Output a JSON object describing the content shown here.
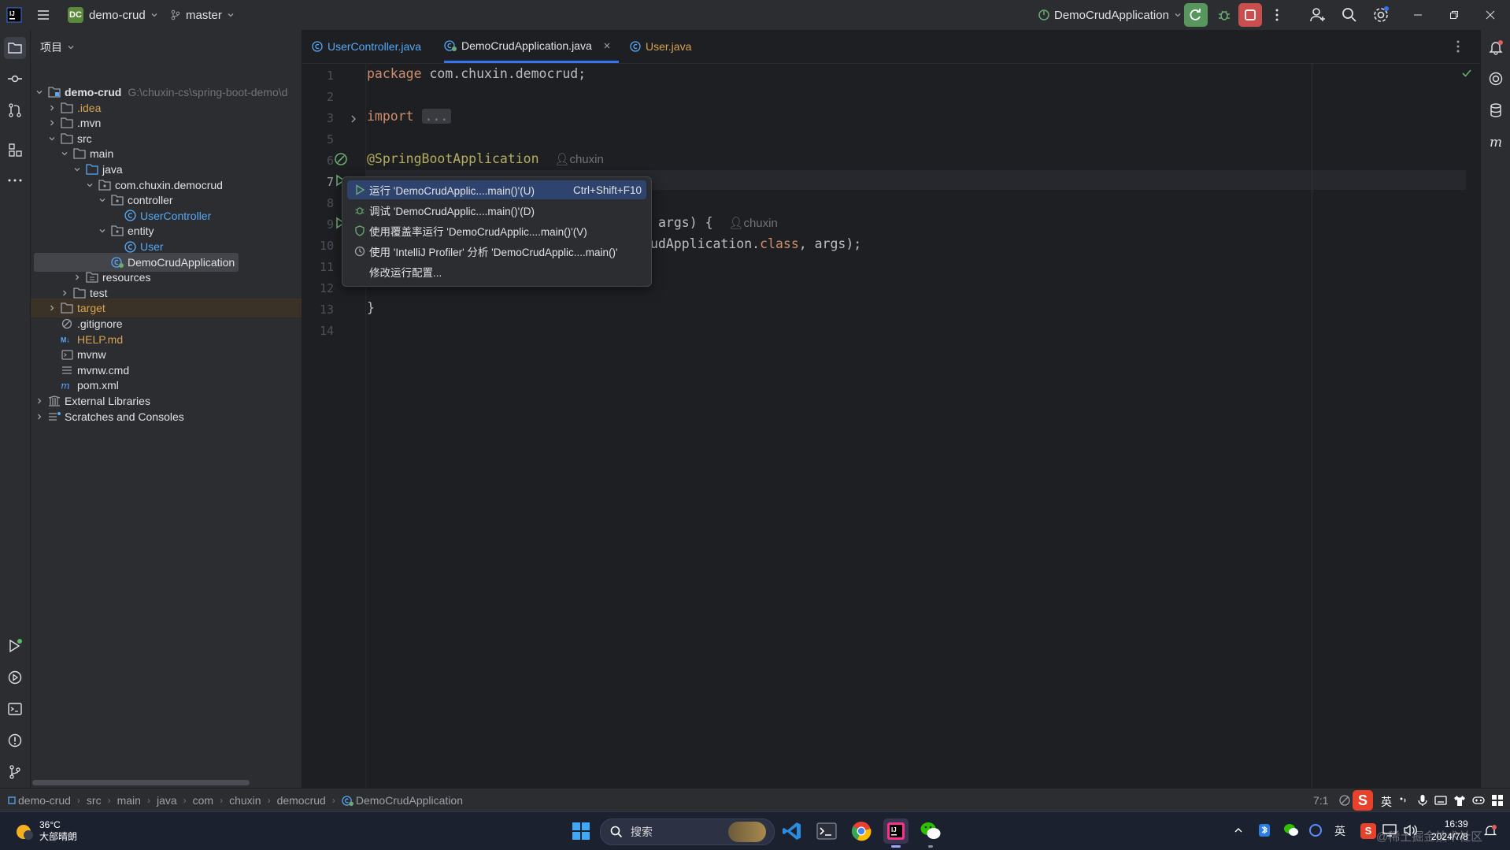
{
  "titlebar": {
    "project_badge": "DC",
    "project_name": "demo-crud",
    "branch": "master",
    "run_config": "DemoCrudApplication"
  },
  "project_panel": {
    "title": "项目",
    "tree": [
      {
        "label": "demo-crud",
        "path": "G:\\chuxin-cs\\spring-boot-demo\\d",
        "level": 0,
        "icon": "module-folder-icon",
        "expanded": true,
        "bold": true
      },
      {
        "label": ".idea",
        "level": 1,
        "icon": "folder-icon",
        "collapsed": true,
        "excluded": true
      },
      {
        "label": ".mvn",
        "level": 1,
        "icon": "folder-icon",
        "collapsed": true
      },
      {
        "label": "src",
        "level": 1,
        "icon": "folder-icon",
        "expanded": true
      },
      {
        "label": "main",
        "level": 2,
        "icon": "folder-icon",
        "expanded": true
      },
      {
        "label": "java",
        "level": 3,
        "icon": "source-folder-icon",
        "expanded": true
      },
      {
        "label": "com.chuxin.democrud",
        "level": 4,
        "icon": "package-icon",
        "expanded": true
      },
      {
        "label": "controller",
        "level": 5,
        "icon": "package-icon",
        "expanded": true
      },
      {
        "label": "UserController",
        "level": 6,
        "icon": "class-icon",
        "leaf": true,
        "cls": true
      },
      {
        "label": "entity",
        "level": 5,
        "icon": "package-icon",
        "expanded": true
      },
      {
        "label": "User",
        "level": 6,
        "icon": "class-icon",
        "leaf": true,
        "cls": true
      },
      {
        "label": "DemoCrudApplication",
        "level": 5,
        "icon": "spring-class-icon",
        "leaf": true,
        "selected": true
      },
      {
        "label": "resources",
        "level": 3,
        "icon": "resources-folder-icon",
        "collapsed": true
      },
      {
        "label": "test",
        "level": 2,
        "icon": "folder-icon",
        "collapsed": true
      },
      {
        "label": "target",
        "level": 1,
        "icon": "folder-icon",
        "collapsed": true,
        "excluded": true,
        "highlight": true
      },
      {
        "label": ".gitignore",
        "level": 1,
        "icon": "ignore-file-icon",
        "leaf": true
      },
      {
        "label": "HELP.md",
        "level": 1,
        "icon": "markdown-icon",
        "leaf": true,
        "excluded": true
      },
      {
        "label": "mvnw",
        "level": 1,
        "icon": "shell-file-icon",
        "leaf": true
      },
      {
        "label": "mvnw.cmd",
        "level": 1,
        "icon": "text-file-icon",
        "leaf": true
      },
      {
        "label": "pom.xml",
        "level": 1,
        "icon": "maven-icon",
        "leaf": true
      },
      {
        "label": "External Libraries",
        "level": 0,
        "icon": "library-icon",
        "collapsed": true
      },
      {
        "label": "Scratches and Consoles",
        "level": 0,
        "icon": "scratches-icon",
        "collapsed": true
      }
    ]
  },
  "tabs": [
    {
      "label": "UserController.java"
    },
    {
      "label": "DemoCrudApplication.java",
      "active": true
    },
    {
      "label": "User.java"
    }
  ],
  "editor": {
    "line_numbers": [
      "1",
      "2",
      "3",
      "5",
      "6",
      "7",
      "8",
      "9",
      "10",
      "11",
      "12",
      "13",
      "14"
    ],
    "line1_kw": "package",
    "line1_rest": " com.chuxin.democrud;",
    "line3_kw": "import",
    "line3_fold": "...",
    "line6_ann": "@SpringBootApplication",
    "author": "chuxin",
    "line9_tail": "args) {",
    "line10_pre": "udApplication.",
    "line10_kw": "class",
    "line10_post": ", args);",
    "line13": "}"
  },
  "popup": {
    "items": [
      {
        "label": "运行 'DemoCrudApplic....main()'(U)",
        "shortcut": "Ctrl+Shift+F10",
        "selected": true
      },
      {
        "label": "调试 'DemoCrudApplic....main()'(D)"
      },
      {
        "label": "使用覆盖率运行 'DemoCrudApplic....main()'(V)"
      },
      {
        "label": "使用 'IntelliJ Profiler' 分析 'DemoCrudApplic....main()'"
      },
      {
        "label": "修改运行配置..."
      }
    ]
  },
  "statusbar": {
    "breadcrumbs": [
      "demo-crud",
      "src",
      "main",
      "java",
      "com",
      "chuxin",
      "democrud",
      "DemoCrudApplication"
    ],
    "caret": "7:1",
    "ime": "英"
  },
  "taskbar": {
    "weather_temp": "36°C",
    "weather_desc": "大部晴朗",
    "search_placeholder": "搜索",
    "ime": "英",
    "time": "16:39",
    "date": "2024/7/8",
    "watermark": "@稀土掘金技术社区"
  }
}
